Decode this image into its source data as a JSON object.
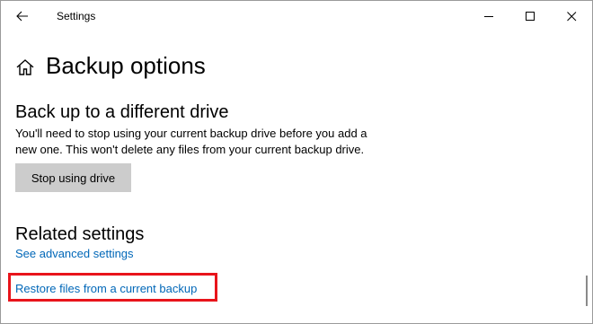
{
  "window": {
    "title": "Settings",
    "controls": [
      "minimize-icon",
      "maximize-icon",
      "close-icon"
    ]
  },
  "header": {
    "icon": "home-icon",
    "title": "Backup options"
  },
  "backup_section": {
    "title": "Back up to a different drive",
    "description_line1": "You'll need to stop using your current backup drive before you add a",
    "description_line2": "new one. This won't delete any files from your current backup drive.",
    "button_label": "Stop using drive"
  },
  "related": {
    "title": "Related settings",
    "links": [
      "See advanced settings",
      "Restore files from a current backup"
    ]
  },
  "colors": {
    "link": "#0067b8",
    "button_bg": "#cccccc",
    "highlight": "#e8141b"
  }
}
